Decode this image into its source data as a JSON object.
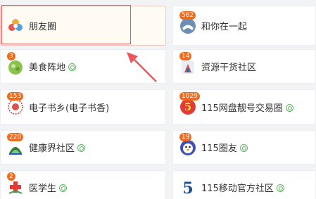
{
  "groups": [
    {
      "name": "朋友圈",
      "badge": "",
      "certified": false
    },
    {
      "name": "和你在一起",
      "badge": "562",
      "certified": false
    },
    {
      "name": "美食阵地",
      "badge": "3",
      "certified": true
    },
    {
      "name": "资源干货社区",
      "badge": "14",
      "certified": false
    },
    {
      "name": "电子书乡(电子书香)",
      "badge": "153",
      "certified": false
    },
    {
      "name": "115网盘靓号交易圈",
      "badge": "1029",
      "certified": true
    },
    {
      "name": "健康界社区",
      "badge": "220",
      "certified": true
    },
    {
      "name": "115圈友",
      "badge": "19",
      "certified": true
    },
    {
      "name": "医学生",
      "badge": "2",
      "certified": true
    },
    {
      "name": "115移动官方社区",
      "badge": "",
      "certified": true
    }
  ],
  "colors": {
    "badge": "#f26b1d",
    "highlight_border": "#e8585a",
    "certified": "#5cb85c"
  }
}
